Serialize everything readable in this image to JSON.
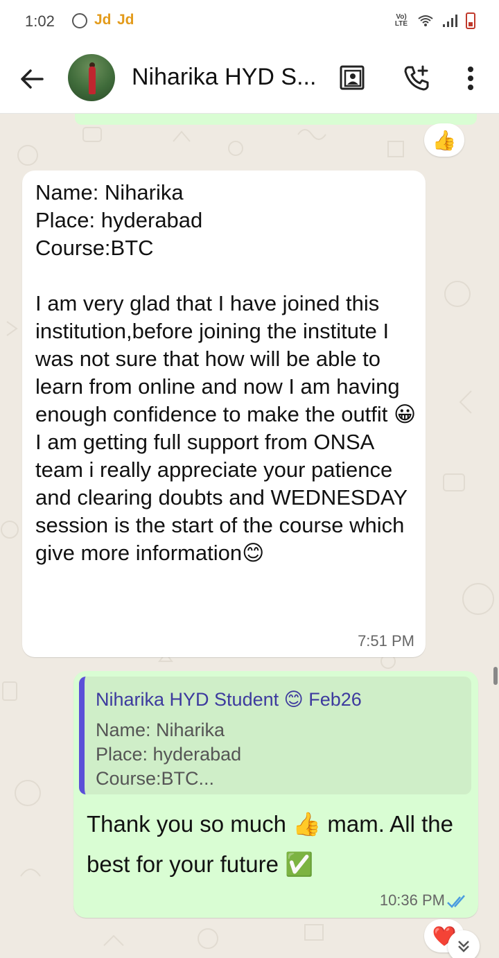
{
  "status_bar": {
    "time": "1:02",
    "notif_1": "Jd",
    "notif_2": "Jd",
    "network_label": "Vo) LTE"
  },
  "header": {
    "contact_name": "Niharika HYD S...",
    "icons": [
      "back-arrow-icon",
      "video-call-icon",
      "add-call-icon",
      "more-vert-icon"
    ]
  },
  "messages": {
    "top_reaction": "👍",
    "incoming": {
      "text": "Name: Niharika\nPlace: hyderabad\nCourse:BTC\n\nI am very glad that I have joined this institution,before joining the institute I was not sure that how will be able to learn from online and now I am having enough confidence to make the outfit 😀\nI am getting full support from ONSA team i really appreciate your patience and clearing doubts and WEDNESDAY session is the start of the course which give more information😊",
      "time": "7:51 PM"
    },
    "outgoing": {
      "quote_author": "Niharika HYD Student 😊 Feb26",
      "quote_text": "Name: Niharika\nPlace: hyderabad\nCourse:BTC...",
      "text": "Thank you so much 👍 mam. All the best for your future ✅",
      "time": "10:36 PM",
      "read_status": "read"
    },
    "bottom_reaction": "❤️"
  },
  "colors": {
    "chat_bg": "#efeae2",
    "incoming_bg": "#ffffff",
    "outgoing_bg": "#d9fdd3",
    "quote_bar": "#5b4fd8",
    "read_tick": "#4a9be0"
  }
}
